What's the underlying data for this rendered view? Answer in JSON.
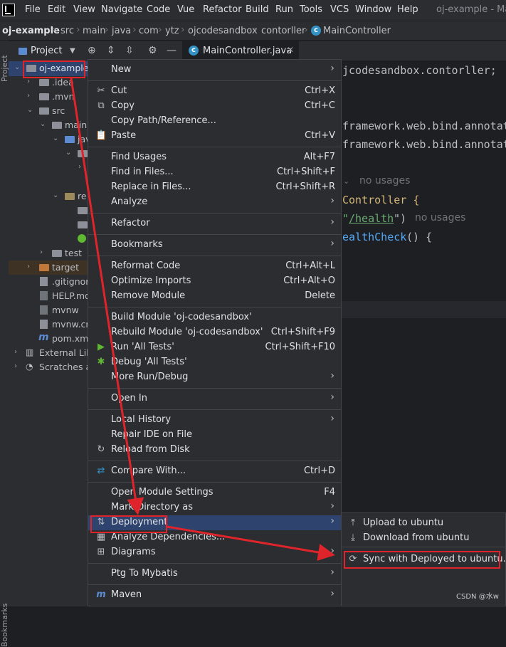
{
  "menubar": {
    "items": [
      "File",
      "Edit",
      "View",
      "Navigate",
      "Code",
      "Vue",
      "Refactor",
      "Build",
      "Run",
      "Tools",
      "VCS",
      "Window",
      "Help"
    ],
    "window_title": "oj-example - Ma"
  },
  "breadcrumb": [
    "oj-example",
    "src",
    "main",
    "java",
    "com",
    "ytz",
    "ojcodesandbox",
    "contorller",
    "MainController"
  ],
  "project_panel": {
    "title": "Project",
    "side_label": "Project",
    "bottom_label": "Bookmarks",
    "tree": [
      {
        "label": "oj-example"
      },
      {
        "label": ".idea"
      },
      {
        "label": ".mvn"
      },
      {
        "label": "src"
      },
      {
        "label": "main"
      },
      {
        "label": "jav"
      },
      {
        "label": "re"
      },
      {
        "label": "test"
      },
      {
        "label": "target"
      },
      {
        "label": ".gitignor"
      },
      {
        "label": "HELP.md"
      },
      {
        "label": "mvnw"
      },
      {
        "label": "mvnw.cm"
      },
      {
        "label": "pom.xml"
      },
      {
        "label": "External Lib"
      },
      {
        "label": "Scratches ar"
      }
    ]
  },
  "editor": {
    "tab_label": "MainController.java",
    "lines": {
      "l1": "jcodesandbox.contorller;",
      "l2": "framework.web.bind.annotat",
      "l3": "framework.web.bind.annotat",
      "l4_hint": "no usages",
      "l5": "Controller {",
      "l6a": "\"",
      "l6b": "/health",
      "l6c": "\")",
      "l6_hint": "no usages",
      "l7a": "ealthCheck",
      "l7b": "() {"
    }
  },
  "context_menu": {
    "items": {
      "new": {
        "label": "New"
      },
      "cut": {
        "label": "Cut",
        "shortcut": "Ctrl+X"
      },
      "copy": {
        "label": "Copy",
        "shortcut": "Ctrl+C"
      },
      "copy_path": {
        "label": "Copy Path/Reference..."
      },
      "paste": {
        "label": "Paste",
        "shortcut": "Ctrl+V"
      },
      "find_usages": {
        "label": "Find Usages",
        "shortcut": "Alt+F7"
      },
      "find_in_files": {
        "label": "Find in Files...",
        "shortcut": "Ctrl+Shift+F"
      },
      "replace_in_files": {
        "label": "Replace in Files...",
        "shortcut": "Ctrl+Shift+R"
      },
      "analyze": {
        "label": "Analyze"
      },
      "refactor": {
        "label": "Refactor"
      },
      "bookmarks": {
        "label": "Bookmarks"
      },
      "reformat": {
        "label": "Reformat Code",
        "shortcut": "Ctrl+Alt+L"
      },
      "optimize": {
        "label": "Optimize Imports",
        "shortcut": "Ctrl+Alt+O"
      },
      "remove_module": {
        "label": "Remove Module",
        "shortcut": "Delete"
      },
      "build_module": {
        "label": "Build Module 'oj-codesandbox'"
      },
      "rebuild_module": {
        "label": "Rebuild Module 'oj-codesandbox'",
        "shortcut": "Ctrl+Shift+F9"
      },
      "run_tests": {
        "label": "Run 'All Tests'",
        "shortcut": "Ctrl+Shift+F10"
      },
      "debug_tests": {
        "label": "Debug 'All Tests'"
      },
      "more_run": {
        "label": "More Run/Debug"
      },
      "open_in": {
        "label": "Open In"
      },
      "local_history": {
        "label": "Local History"
      },
      "repair_ide": {
        "label": "Repair IDE on File"
      },
      "reload": {
        "label": "Reload from Disk"
      },
      "compare": {
        "label": "Compare With...",
        "shortcut": "Ctrl+D"
      },
      "module_settings": {
        "label": "Open Module Settings",
        "shortcut": "F4"
      },
      "mark_dir": {
        "label": "Mark Directory as"
      },
      "deployment": {
        "label": "Deployment"
      },
      "analyze_deps": {
        "label": "Analyze Dependencies..."
      },
      "diagrams": {
        "label": "Diagrams"
      },
      "ptg": {
        "label": "Ptg To Mybatis"
      },
      "maven": {
        "label": "Maven"
      }
    }
  },
  "deployment_submenu": {
    "upload": "Upload to ubuntu",
    "download": "Download from ubuntu",
    "sync": "Sync with Deployed to ubuntu..."
  },
  "watermark": "CSDN @水w",
  "colors": {
    "background": "#1e1f22",
    "panel": "#2b2d30",
    "selection": "#2e436e",
    "annotation_red": "#e0242b",
    "code_orange": "#d5b778"
  }
}
